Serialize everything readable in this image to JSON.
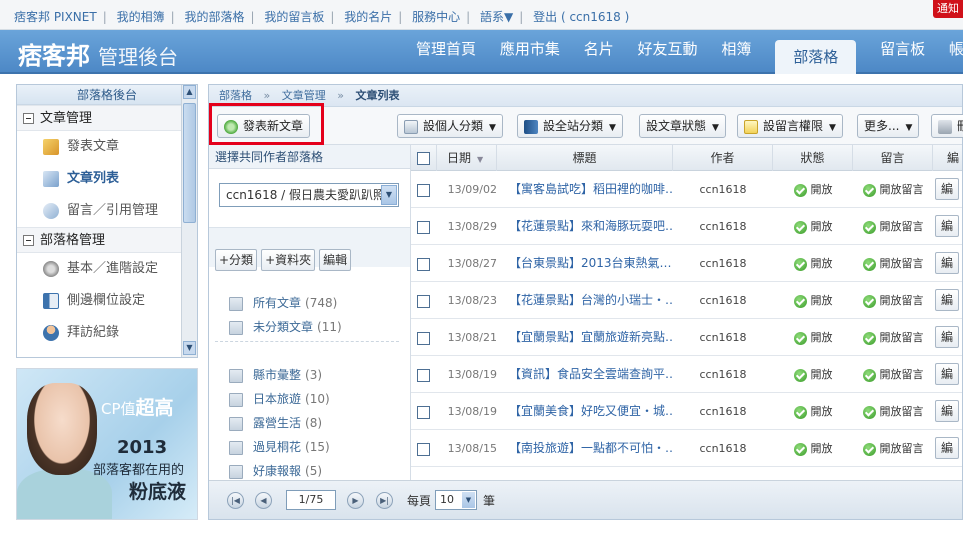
{
  "topbar": {
    "links": [
      "痞客邦 PIXNET",
      "我的相簿",
      "我的部落格",
      "我的留言板",
      "我的名片",
      "服務中心",
      "語系▼",
      "登出 ( ccn1618 )"
    ],
    "notify_label": "通知"
  },
  "header": {
    "logo_main": "痞客邦",
    "logo_sub": "管理後台",
    "nav": [
      "管理首頁",
      "應用市集",
      "名片",
      "好友互動",
      "相簿",
      "部落格",
      "留言板",
      "帳戶"
    ],
    "active_nav": "部落格"
  },
  "sidebar": {
    "title": "部落格後台",
    "sections": [
      {
        "label": "文章管理",
        "items": [
          {
            "label": "發表文章",
            "icon": "pencil-icon"
          },
          {
            "label": "文章列表",
            "icon": "pages-icon",
            "current": true
          },
          {
            "label": "留言／引用管理",
            "icon": "comment-icon"
          }
        ]
      },
      {
        "label": "部落格管理",
        "items": [
          {
            "label": "基本／進階設定",
            "icon": "gear-icon"
          },
          {
            "label": "側邊欄位設定",
            "icon": "layout-icon"
          },
          {
            "label": "拜訪紀錄",
            "icon": "users-icon"
          }
        ]
      }
    ]
  },
  "ad": {
    "line1_prefix": "CP值",
    "line1_emph": "超高",
    "line2": "2013",
    "line3": "部落客都在用的",
    "line4": "粉底液"
  },
  "main": {
    "breadcrumb": [
      "部落格",
      "文章管理",
      "文章列表"
    ],
    "toolbar": {
      "new_post": "發表新文章",
      "personal_category": "設個人分類",
      "site_category": "設全站分類",
      "post_status": "設文章狀態",
      "comment_permission": "設留言權限",
      "more": "更多...",
      "delete": "刪"
    },
    "category_panel": {
      "title": "選擇共同作者部落格",
      "selected_blog": "ccn1618 / 假日農夫愛趴趴照",
      "buttons": [
        "+分類",
        "+資料夾",
        "編輯"
      ],
      "categories": [
        {
          "label": "所有文章",
          "count": "(748)"
        },
        {
          "label": "未分類文章",
          "count": "(11)"
        },
        {
          "label": "縣市彙整",
          "count": "(3)"
        },
        {
          "label": "日本旅遊",
          "count": "(10)"
        },
        {
          "label": "露營生活",
          "count": "(8)"
        },
        {
          "label": "過見桐花",
          "count": "(15)"
        },
        {
          "label": "好康報報",
          "count": "(5)"
        }
      ]
    },
    "table": {
      "headers": {
        "date": "日期",
        "title": "標題",
        "author": "作者",
        "status": "狀態",
        "comment": "留言",
        "edit": "編"
      },
      "rows": [
        {
          "date": "13/09/02",
          "title": "【寓客島試吃】稻田裡的咖啡…",
          "author": "ccn1618",
          "status": "開放",
          "comment": "開放留言",
          "edit": "編"
        },
        {
          "date": "13/08/29",
          "title": "【花蓮景點】來和海豚玩耍吧…",
          "author": "ccn1618",
          "status": "開放",
          "comment": "開放留言",
          "edit": "編"
        },
        {
          "date": "13/08/27",
          "title": "【台東景點】2013台東熱氣…",
          "author": "ccn1618",
          "status": "開放",
          "comment": "開放留言",
          "edit": "編"
        },
        {
          "date": "13/08/23",
          "title": "【花蓮景點】台灣的小瑞士・…",
          "author": "ccn1618",
          "status": "開放",
          "comment": "開放留言",
          "edit": "編"
        },
        {
          "date": "13/08/21",
          "title": "【宜蘭景點】宜蘭旅遊新亮點…",
          "author": "ccn1618",
          "status": "開放",
          "comment": "開放留言",
          "edit": "編"
        },
        {
          "date": "13/08/19",
          "title": "【資訊】食品安全雲端查詢平…",
          "author": "ccn1618",
          "status": "開放",
          "comment": "開放留言",
          "edit": "編"
        },
        {
          "date": "13/08/19",
          "title": "【宜蘭美食】好吃又便宜・城…",
          "author": "ccn1618",
          "status": "開放",
          "comment": "開放留言",
          "edit": "編"
        },
        {
          "date": "13/08/15",
          "title": "【南投旅遊】一點都不可怕・…",
          "author": "ccn1618",
          "status": "開放",
          "comment": "開放留言",
          "edit": "編"
        }
      ]
    },
    "pager": {
      "page_value": "1/75",
      "per_page_label": "每頁",
      "per_page_value": "10",
      "unit_label": "筆"
    }
  },
  "colors": {
    "header_blue": "#4d88c6",
    "link_blue": "#2f64a6",
    "highlight_red": "#e4001b",
    "status_green": "#3a9b2a"
  }
}
